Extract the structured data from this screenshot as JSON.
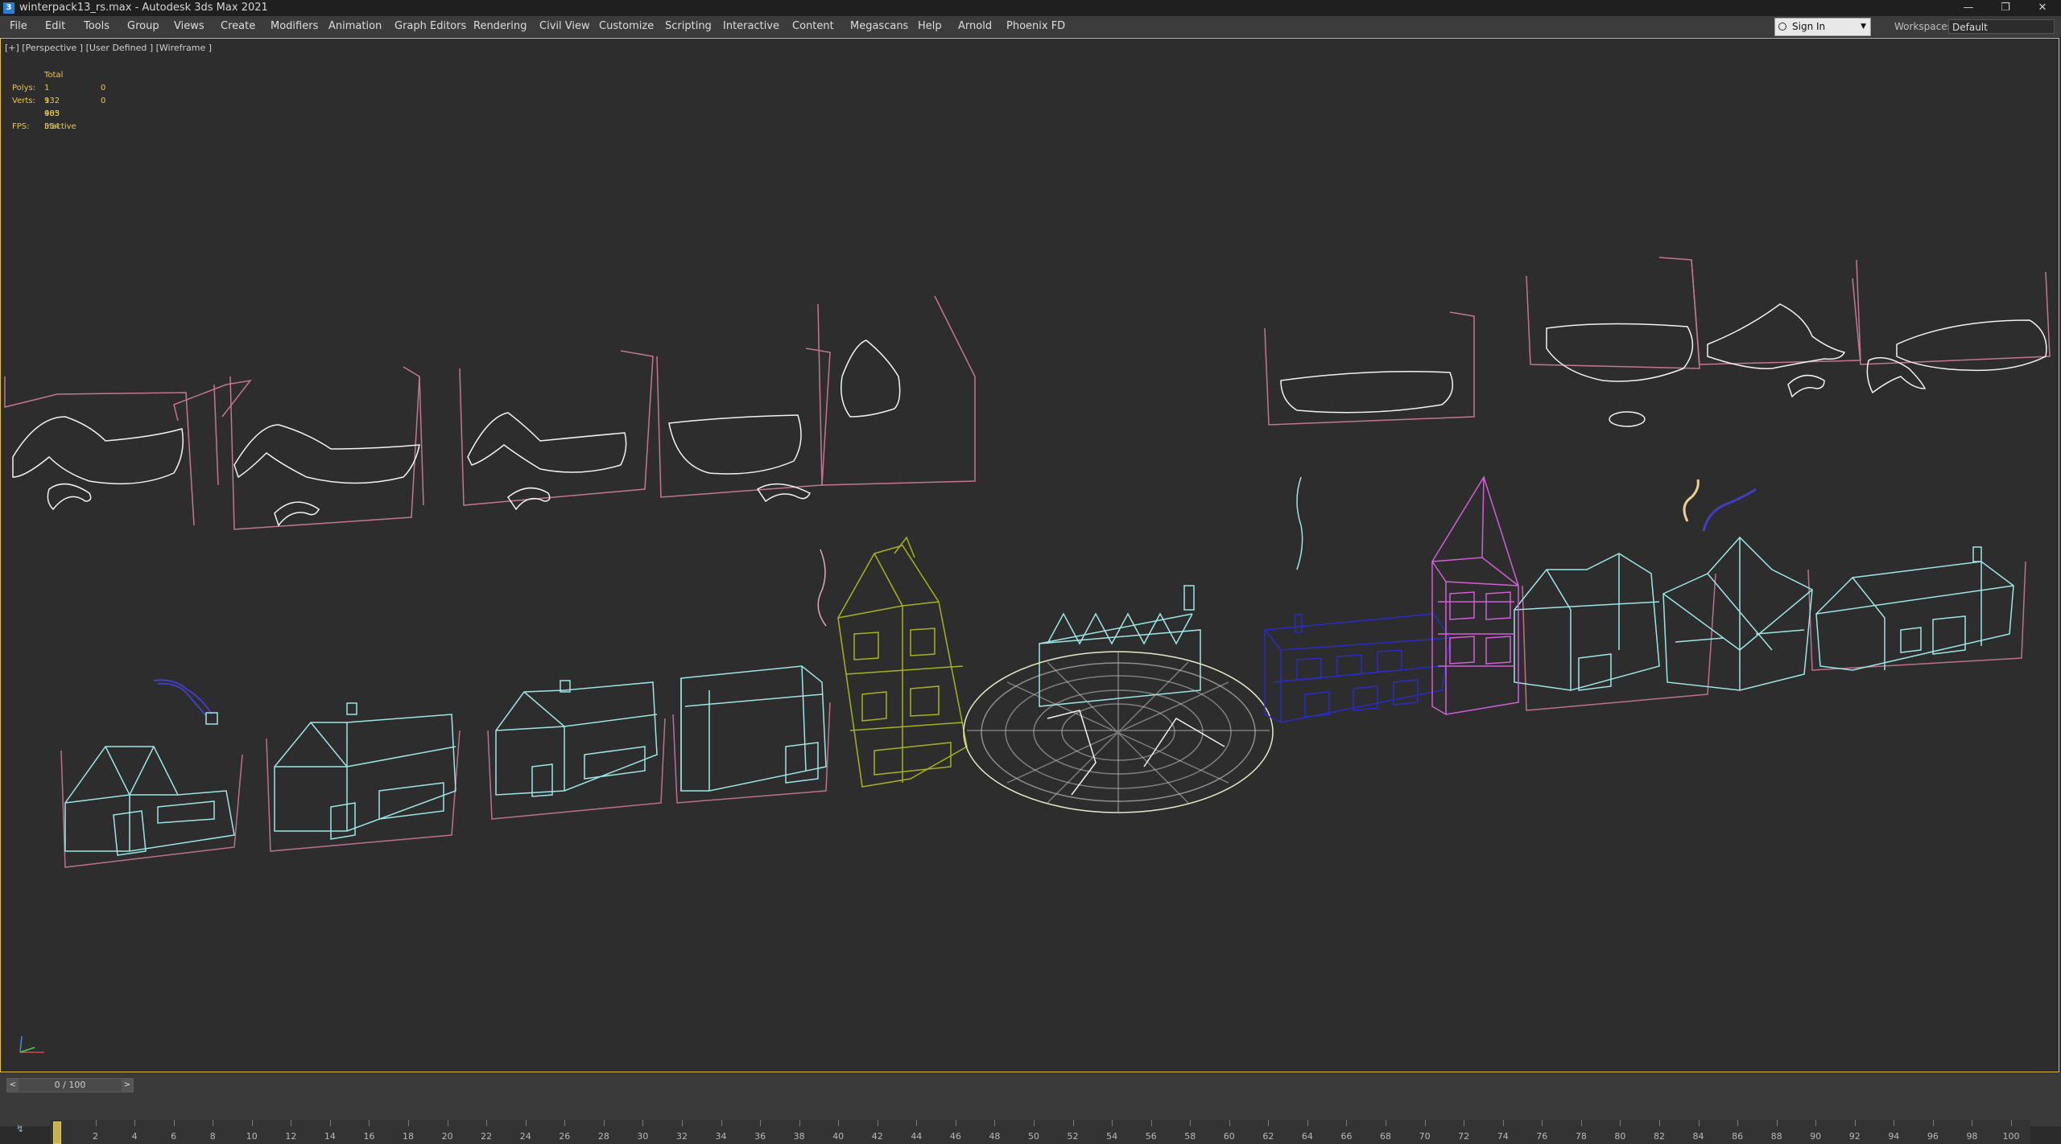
{
  "window": {
    "title": "winterpack13_rs.max - Autodesk 3ds Max 2021",
    "app_icon": "3"
  },
  "menu": {
    "items": [
      "File",
      "Edit",
      "Tools",
      "Group",
      "Views",
      "Create",
      "Modifiers",
      "Animation",
      "Graph Editors",
      "Rendering",
      "Civil View",
      "Customize",
      "Scripting",
      "Interactive",
      "Content",
      "Megascans",
      "Help",
      "Arnold",
      "Phoenix FD"
    ],
    "sign_in": "Sign In",
    "workspaces_label": "Workspaces:",
    "workspace_value": "Default"
  },
  "viewport": {
    "label": "[+] [Perspective ] [User Defined ] [Wireframe ]",
    "stats": {
      "header": "Total",
      "polys_label": "Polys:",
      "polys_value": "1 932 485",
      "polys_sel": "0",
      "verts_label": "Verts:",
      "verts_value": "1 903 554",
      "verts_sel": "0",
      "fps_label": "FPS:",
      "fps_value": "Inactive"
    }
  },
  "timeline": {
    "position": "0 / 100",
    "ticks": [
      "2",
      "4",
      "6",
      "8",
      "10",
      "12",
      "14",
      "16",
      "18",
      "20",
      "22",
      "24",
      "26",
      "28",
      "30",
      "32",
      "34",
      "36",
      "38",
      "40",
      "42",
      "44",
      "46",
      "48",
      "50",
      "52",
      "54",
      "56",
      "58",
      "60",
      "62",
      "64",
      "66",
      "68",
      "70",
      "72",
      "74",
      "76",
      "78",
      "80",
      "82",
      "84",
      "86",
      "88",
      "90",
      "92",
      "94",
      "96",
      "98",
      "100"
    ]
  },
  "icons": {
    "app": "3ds-max-icon",
    "minimize": "minimize-icon",
    "restore": "restore-icon",
    "close": "close-icon",
    "user": "user-icon",
    "key": "key-mode-icon"
  }
}
